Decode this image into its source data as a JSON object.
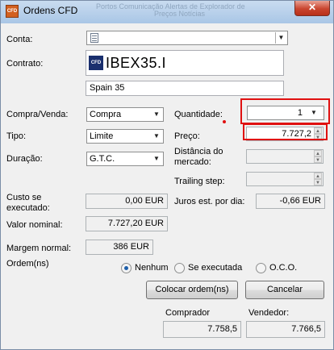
{
  "window": {
    "title": "Ordens CFD",
    "app_icon": "CFD",
    "close_glyph": "✕",
    "background_text_1": "Portos   Comunicação   Alertas de   Explorador de",
    "background_text_2": "Preços                Notícias"
  },
  "form": {
    "conta_label": "Conta:",
    "conta_value": "",
    "contrato_label": "Contrato:",
    "contrato_value": "IBEX35.I",
    "contrato_badge": "CFD",
    "contrato_description": "Spain 35",
    "compra_venda_label": "Compra/Venda:",
    "compra_venda_value": "Compra",
    "tipo_label": "Tipo:",
    "tipo_value": "Limite",
    "duracao_label": "Duração:",
    "duracao_value": "G.T.C.",
    "quantidade_label": "Quantidade:",
    "quantidade_value": "1",
    "preco_label": "Preço:",
    "preco_value": "7.727,2",
    "distancia_label_1": "Distância do",
    "distancia_label_2": "mercado:",
    "trailing_label": "Trailing step:",
    "custo_label_1": "Custo se",
    "custo_label_2": "executado:",
    "custo_value": "0,00 EUR",
    "juros_label": "Juros est. por dia:",
    "juros_value": "-0,66 EUR",
    "valor_label": "Valor nominal:",
    "valor_value": "7.727,20 EUR",
    "margem_label": "Margem normal:",
    "margem_value": "386 EUR",
    "ordens_label": "Ordem(ns)",
    "radio_nenhum": "Nenhum",
    "radio_se_executada": "Se executada",
    "radio_oco": "O.C.O.",
    "radio_selected": "Nenhum",
    "colocar_button": "Colocar ordem(ns)",
    "cancelar_button": "Cancelar",
    "comprador_label": "Comprador",
    "comprador_value": "7.758,5",
    "vendedor_label": "Vendedor:",
    "vendedor_value": "7.766,5"
  },
  "colors": {
    "annotation_red": "#e01010",
    "selected_radio": "#1e5faa",
    "close_button": "#c9452f"
  }
}
